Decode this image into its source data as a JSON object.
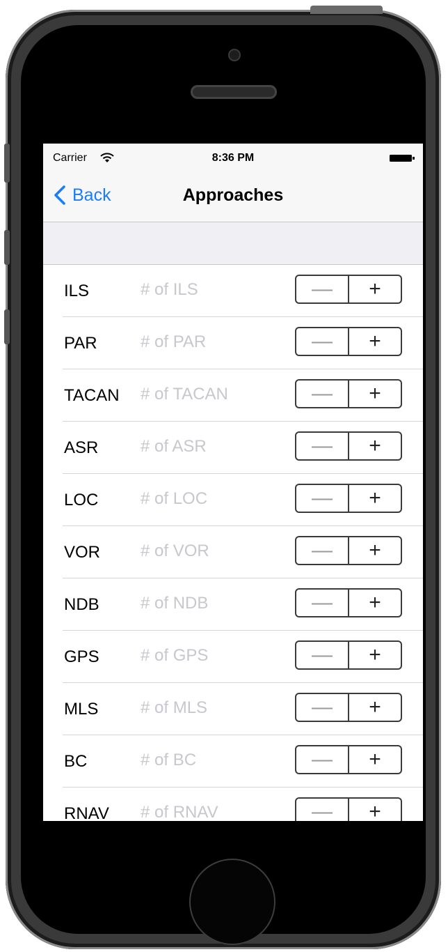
{
  "status_bar": {
    "carrier": "Carrier",
    "time": "8:36 PM"
  },
  "navbar": {
    "back_label": "Back",
    "title": "Approaches"
  },
  "stepper": {
    "minus": "—",
    "plus": "+"
  },
  "rows": [
    {
      "label": "ILS",
      "placeholder": "# of ILS",
      "value": ""
    },
    {
      "label": "PAR",
      "placeholder": "# of PAR",
      "value": ""
    },
    {
      "label": "TACAN",
      "placeholder": "# of TACAN",
      "value": ""
    },
    {
      "label": "ASR",
      "placeholder": "# of ASR",
      "value": ""
    },
    {
      "label": "LOC",
      "placeholder": "# of LOC",
      "value": ""
    },
    {
      "label": "VOR",
      "placeholder": "# of VOR",
      "value": ""
    },
    {
      "label": "NDB",
      "placeholder": "# of NDB",
      "value": ""
    },
    {
      "label": "GPS",
      "placeholder": "# of GPS",
      "value": ""
    },
    {
      "label": "MLS",
      "placeholder": "# of MLS",
      "value": ""
    },
    {
      "label": "BC",
      "placeholder": "# of BC",
      "value": ""
    },
    {
      "label": "RNAV",
      "placeholder": "# of RNAV",
      "value": ""
    }
  ],
  "colors": {
    "accent": "#1a7dfb",
    "placeholder": "#c7c7cd",
    "navbar_bg": "#f7f7f7",
    "section_bg": "#efeff4"
  }
}
